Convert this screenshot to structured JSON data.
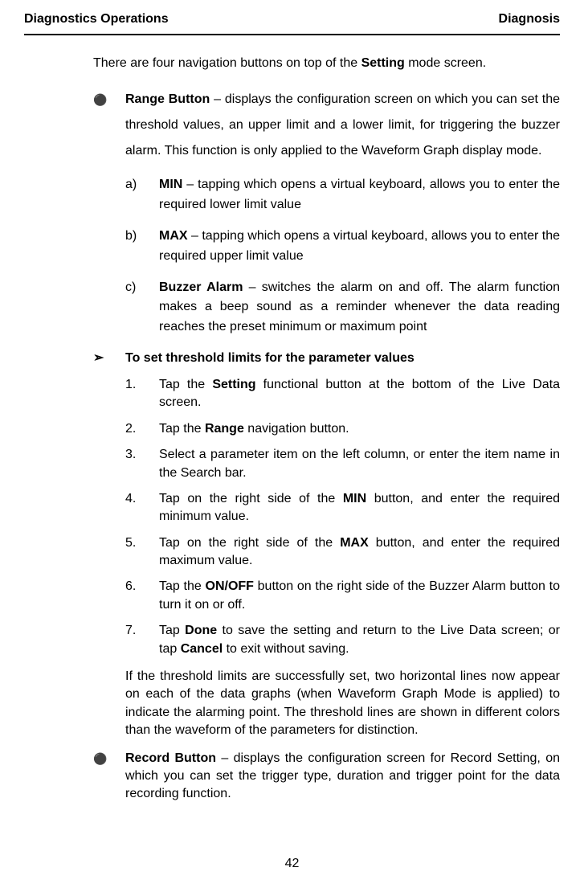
{
  "header": {
    "left": "Diagnostics Operations",
    "right": "Diagnosis"
  },
  "intro": {
    "pre": "There are four navigation buttons on top of the ",
    "bold": "Setting",
    "post": " mode screen."
  },
  "range": {
    "title": "Range Button",
    "desc": " – displays the configuration screen on which you can set the threshold values, an upper limit and a lower limit, for triggering the buzzer alarm. This function is only applied to the Waveform Graph display mode.",
    "a": {
      "marker": "a)",
      "bold": "MIN",
      "rest": " – tapping which opens a virtual keyboard, allows you to enter the required lower limit value"
    },
    "b": {
      "marker": "b)",
      "bold": "MAX",
      "rest": " – tapping which opens a virtual keyboard, allows you to enter the required upper limit value"
    },
    "c": {
      "marker": "c)",
      "bold": "Buzzer Alarm",
      "rest": " – switches the alarm on and off. The alarm function makes a beep sound as a reminder whenever the data reading reaches the preset minimum or maximum point"
    }
  },
  "procedure": {
    "heading": "To set threshold limits for the parameter values",
    "s1": {
      "n": "1.",
      "pre": "Tap the ",
      "b": "Setting",
      "post": " functional button at the bottom of the Live Data screen."
    },
    "s2": {
      "n": "2.",
      "pre": "Tap the ",
      "b": "Range",
      "post": " navigation button."
    },
    "s3": {
      "n": "3.",
      "text": "Select a parameter item on the left column, or enter the item name in the Search bar."
    },
    "s4": {
      "n": "4.",
      "pre": "Tap on the right side of the ",
      "b": "MIN",
      "post": " button, and enter the required minimum value."
    },
    "s5": {
      "n": "5.",
      "pre": "Tap on the right side of the ",
      "b": "MAX",
      "post": " button, and enter the required maximum value."
    },
    "s6": {
      "n": "6.",
      "pre": "Tap the ",
      "b": "ON/OFF",
      "post": " button on the right side of the Buzzer Alarm button to turn it on or off."
    },
    "s7": {
      "n": "7.",
      "pre": "Tap ",
      "b1": "Done",
      "mid": " to save the setting and return to the Live Data screen; or tap ",
      "b2": "Cancel",
      "post": " to exit without saving."
    },
    "result": "If the threshold limits are successfully set, two horizontal lines now appear on each of the data graphs (when Waveform Graph Mode is applied) to indicate the alarming point. The threshold lines are shown in different colors than the waveform of the parameters for distinction."
  },
  "record": {
    "title": "Record Button",
    "desc": " – displays the configuration screen for Record Setting, on which you can set the trigger type, duration and trigger point for the data recording function."
  },
  "page": "42"
}
